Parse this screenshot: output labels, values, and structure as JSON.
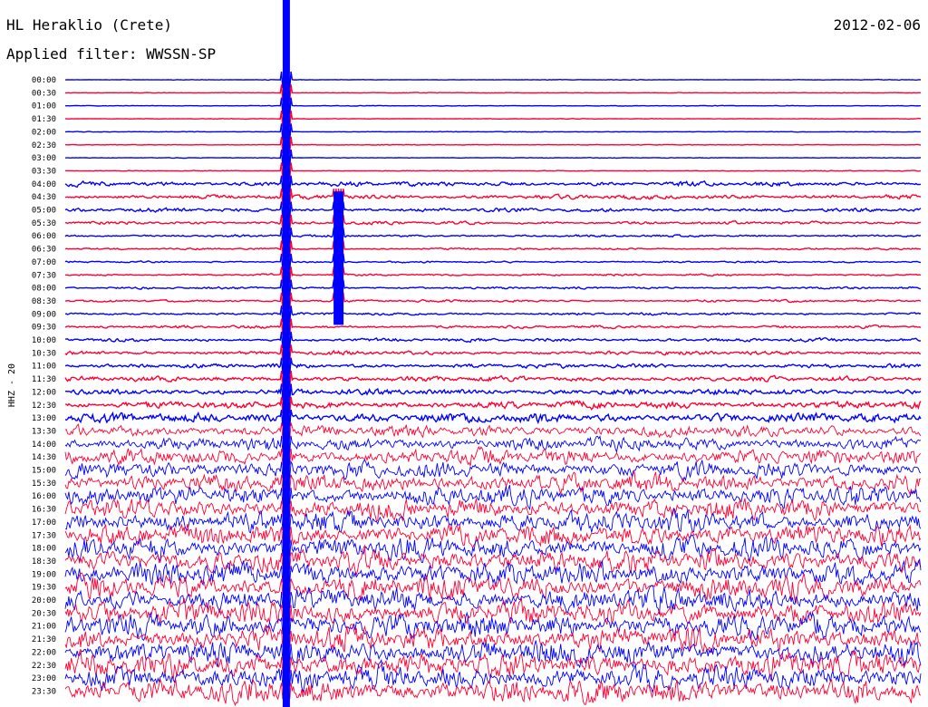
{
  "header": {
    "station": "HL Heraklio (Crete)",
    "filter": "Applied filter: WWSSN-SP",
    "date": "2012-02-06"
  },
  "chart_data": {
    "type": "line",
    "title": "HL Heraklio (Crete)",
    "subtitle": "Applied filter: WWSSN-SP",
    "date": "2012-02-06",
    "ylabel": "HHZ - 20",
    "y_tick_labels": [
      "00:00",
      "00:30",
      "01:00",
      "01:30",
      "02:00",
      "02:30",
      "03:00",
      "03:30",
      "04:00",
      "04:30",
      "05:00",
      "05:30",
      "06:00",
      "06:30",
      "07:00",
      "07:30",
      "08:00",
      "08:30",
      "09:00",
      "09:30",
      "10:00",
      "10:30",
      "11:00",
      "11:30",
      "12:00",
      "12:30",
      "13:00",
      "13:30",
      "14:00",
      "14:30",
      "15:00",
      "15:30",
      "16:00",
      "16:30",
      "17:00",
      "17:30",
      "18:00",
      "18:30",
      "19:00",
      "19:30",
      "20:00",
      "20:30",
      "21:00",
      "21:30",
      "22:00",
      "22:30",
      "23:00",
      "23:30"
    ],
    "trace_minutes": 30,
    "trace_colors": [
      "#0000ff",
      "#ff0033"
    ],
    "noise_level_by_trace": [
      0.12,
      0.12,
      0.12,
      0.12,
      0.12,
      0.13,
      0.13,
      0.15,
      0.9,
      0.85,
      0.75,
      0.6,
      0.45,
      0.35,
      0.35,
      0.38,
      0.42,
      0.45,
      0.5,
      0.55,
      0.65,
      0.75,
      0.85,
      1.0,
      1.2,
      1.5,
      1.9,
      2.4,
      2.8,
      3.2,
      3.5,
      3.8,
      4.0,
      4.2,
      4.4,
      4.5,
      4.6,
      4.7,
      4.8,
      4.8,
      4.9,
      4.9,
      5.0,
      5.0,
      5.0,
      5.0,
      5.0,
      5.0
    ],
    "events": [
      {
        "time": "00:00",
        "until": "23:59",
        "minute": 7.75,
        "amplitude": "clipped"
      },
      {
        "time": "04:30",
        "until": "09:00",
        "minute": 9.6,
        "amplitude": "clipped"
      }
    ]
  }
}
